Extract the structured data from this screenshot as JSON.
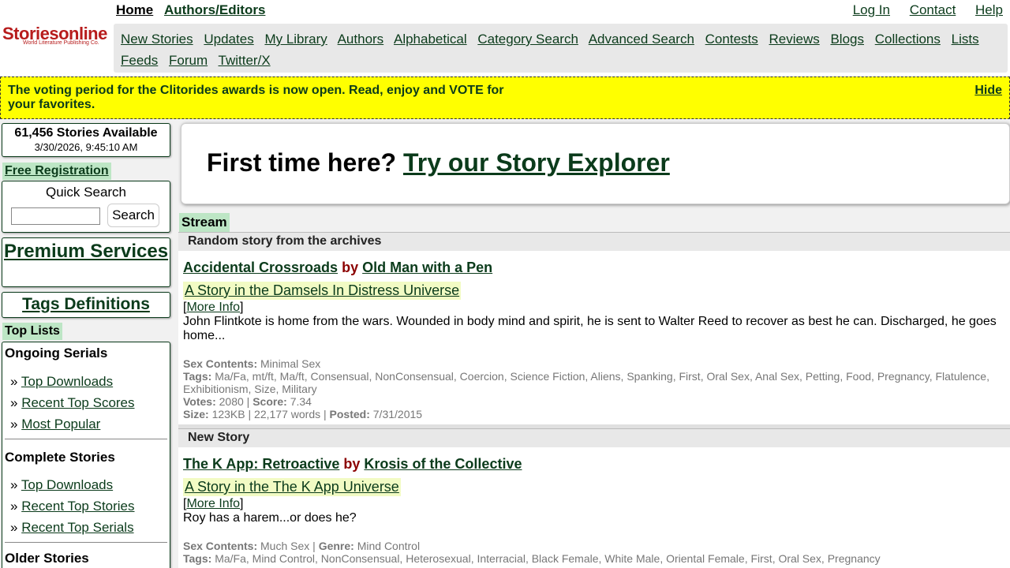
{
  "logo": {
    "main": "Storiesonline",
    "sub": "World Literature Publishing Co."
  },
  "topnav": {
    "home": "Home",
    "authors_editors": "Authors/Editors"
  },
  "toplinks": {
    "login": "Log In",
    "contact": "Contact",
    "help": "Help"
  },
  "mainnav": {
    "items": [
      "New Stories",
      "Updates",
      "My Library",
      "Authors",
      "Alphabetical",
      "Category Search",
      "Advanced Search",
      "Contests",
      "Reviews",
      "Blogs",
      "Collections",
      "Lists",
      "Feeds",
      "Forum",
      "Twitter/X"
    ]
  },
  "alert": {
    "text": "The voting period for the Clitorides awards is now open. Read, enjoy and VOTE for your favorites.",
    "hide": "Hide"
  },
  "sidebar": {
    "stats": {
      "count": "61,456 Stories Available",
      "time": "3/30/2026, 9:45:10 AM"
    },
    "free_registration": "Free Registration",
    "quick_search": {
      "title": "Quick Search",
      "button": "Search",
      "value": ""
    },
    "premium": "Premium Services",
    "tags_definitions": "Tags Definitions",
    "top_lists_tab": "Top Lists",
    "ongoing": {
      "title": "Ongoing Serials",
      "links": [
        "Top Downloads",
        "Recent Top Scores",
        "Most Popular"
      ]
    },
    "complete": {
      "title": "Complete Stories",
      "links": [
        "Top Downloads",
        "Recent Top Stories",
        "Recent Top Serials"
      ]
    },
    "older": {
      "title": "Older Stories"
    }
  },
  "explorer": {
    "prompt": "First time here?",
    "link": "Try our Story Explorer"
  },
  "stream": {
    "tab": "Stream",
    "sections": [
      {
        "head": "Random story from the archives",
        "title": "Accidental Crossroads",
        "by": "by",
        "author": "Old Man with a Pen",
        "universe": "A Story in the Damsels In Distress Universe",
        "more_info": "More Info",
        "desc": "John Flintkote is home from the wars. Wounded in body mind and spirit, he is sent to Walter Reed to recover as best he can. Discharged, he goes home...",
        "sex_label": "Sex Contents:",
        "sex": "Minimal Sex",
        "tags_label": "Tags:",
        "tags": "Ma/Fa, mt/ft, Ma/ft, Consensual, NonConsensual, Coercion, Science Fiction, Aliens, Spanking, First, Oral Sex, Anal Sex, Petting, Food, Pregnancy, Flatulence, Exhibitionism, Size, Military",
        "votes_label": "Votes:",
        "votes": "2080",
        "score_label": "Score:",
        "score": "7.34",
        "size_label": "Size:",
        "size": "123KB",
        "words": "22,177 words",
        "posted_label": "Posted:",
        "posted": "7/31/2015"
      },
      {
        "head": "New Story",
        "title": "The K App: Retroactive",
        "by": "by",
        "author": "Krosis of the Collective",
        "universe": "A Story in the The K App Universe",
        "more_info": "More Info",
        "desc": "Roy has a harem...or does he?",
        "sex_label": "Sex Contents:",
        "sex": "Much Sex",
        "genre_label": "Genre:",
        "genre": "Mind Control",
        "tags_label": "Tags:",
        "tags": "Ma/Fa, Mind Control, NonConsensual, Heterosexual, Interracial, Black Female, White Male, Oriental Female, First, Oral Sex, Pregnancy"
      }
    ]
  }
}
